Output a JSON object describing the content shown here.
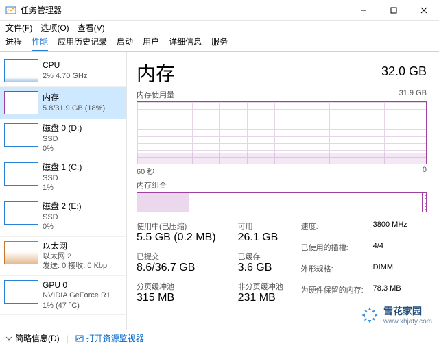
{
  "window": {
    "title": "任务管理器"
  },
  "menu": {
    "file": "文件(F)",
    "options": "选项(O)",
    "view": "查看(V)"
  },
  "tabs": [
    "进程",
    "性能",
    "应用历史记录",
    "启动",
    "用户",
    "详细信息",
    "服务"
  ],
  "activeTab": 1,
  "sidebar": {
    "items": [
      {
        "title": "CPU",
        "line2": "2%  4.70 GHz",
        "line3": ""
      },
      {
        "title": "内存",
        "line2": "5.8/31.9 GB (18%)",
        "line3": ""
      },
      {
        "title": "磁盘 0 (D:)",
        "line2": "SSD",
        "line3": "0%"
      },
      {
        "title": "磁盘 1 (C:)",
        "line2": "SSD",
        "line3": "1%"
      },
      {
        "title": "磁盘 2 (E:)",
        "line2": "SSD",
        "line3": "0%"
      },
      {
        "title": "以太网",
        "line2": "以太网 2",
        "line3": "发送: 0  接收: 0 Kbp"
      },
      {
        "title": "GPU 0",
        "line2": "NVIDIA GeForce R1",
        "line3": "1% (47 °C)"
      }
    ],
    "activeIndex": 1
  },
  "detail": {
    "heading": "内存",
    "capacity": "32.0 GB",
    "usageChart": {
      "label": "内存使用量",
      "max": "31.9 GB",
      "axisLeft": "60 秒",
      "axisRight": "0"
    },
    "compChart": {
      "label": "内存组合"
    },
    "stats": {
      "inUseLabel": "使用中(已压缩)",
      "inUseValue": "5.5 GB (0.2 MB)",
      "availLabel": "可用",
      "availValue": "26.1 GB",
      "commitLabel": "已提交",
      "commitValue": "8.6/36.7 GB",
      "cachedLabel": "已缓存",
      "cachedValue": "3.6 GB",
      "pagedLabel": "分页缓冲池",
      "pagedValue": "315 MB",
      "nonPagedLabel": "非分页缓冲池",
      "nonPagedValue": "231 MB"
    },
    "right": {
      "speedL": "速度:",
      "speedV": "3800 MHz",
      "slotsL": "已使用的插槽:",
      "slotsV": "4/4",
      "formL": "外形规格:",
      "formV": "DIMM",
      "hwResL": "为硬件保留的内存:",
      "hwResV": "78.3 MB"
    }
  },
  "status": {
    "brief": "简略信息(D)",
    "link": "打开资源监视器"
  },
  "watermark": {
    "name": "雪花家园",
    "url": "www.xhjaty.com"
  },
  "chart_data": {
    "type": "area",
    "title": "内存使用量",
    "x": [
      60,
      50,
      40,
      30,
      20,
      10,
      0
    ],
    "values": [
      5.8,
      5.8,
      5.8,
      5.8,
      5.8,
      5.8,
      5.8
    ],
    "xlabel": "秒",
    "ylabel": "GB",
    "ylim": [
      0,
      31.9
    ]
  }
}
